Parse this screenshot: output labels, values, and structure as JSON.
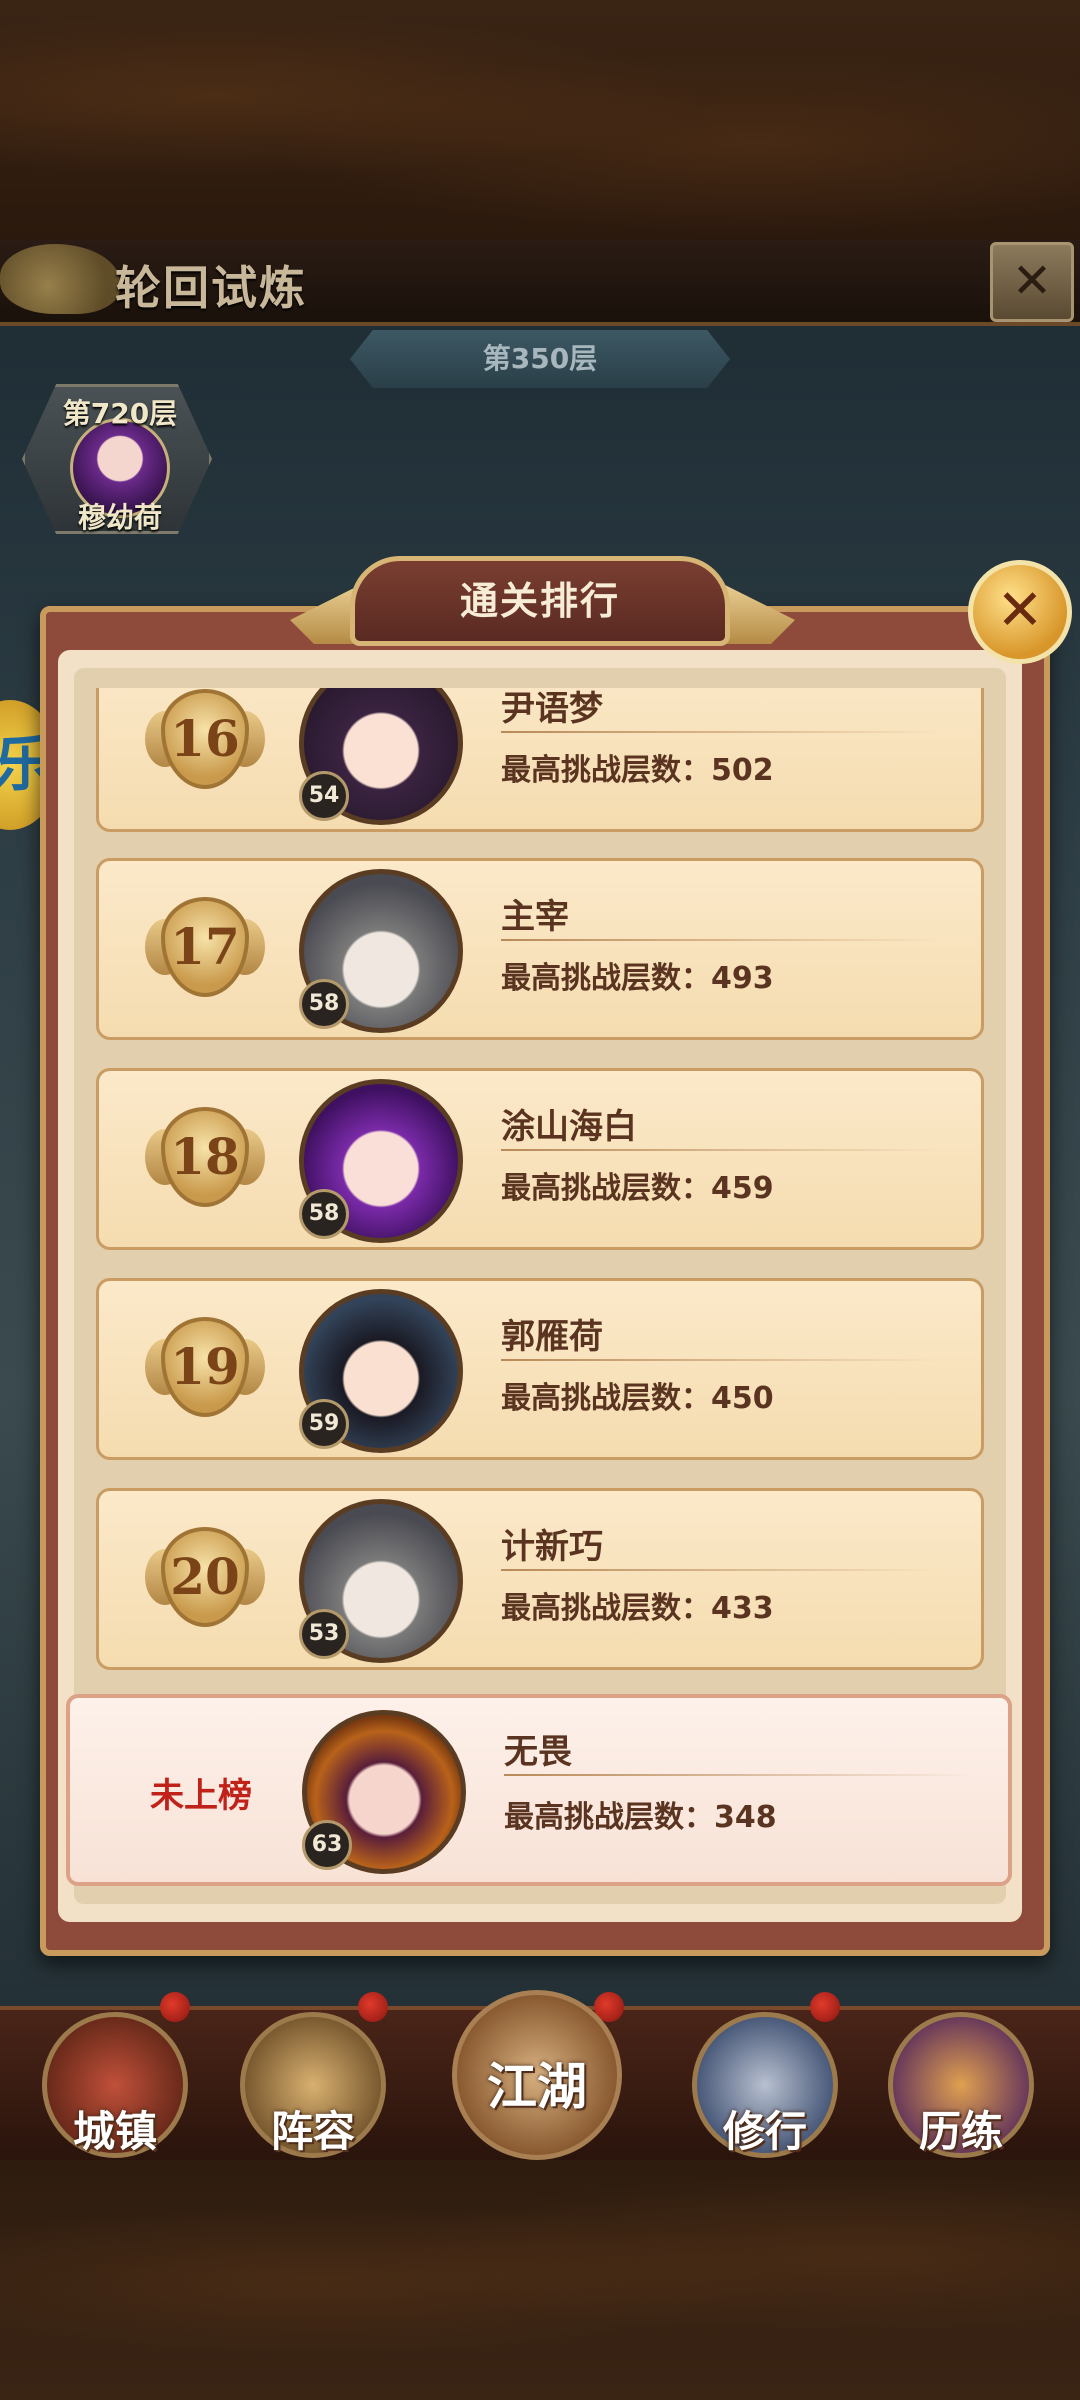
{
  "header": {
    "title": "轮回试炼",
    "close_icon": "x-icon",
    "floor_label": "第350层"
  },
  "top_badge": {
    "floor": "第720层",
    "name": "穆幼荷"
  },
  "panel": {
    "title": "通关排行",
    "close_icon": "x-icon"
  },
  "rankings": [
    {
      "rank": "16",
      "level": "54",
      "name": "尹语梦",
      "score": "最高挑战层数：502"
    },
    {
      "rank": "17",
      "level": "58",
      "name": "主宰",
      "score": "最高挑战层数：493"
    },
    {
      "rank": "18",
      "level": "58",
      "name": "涂山海白",
      "score": "最高挑战层数：459"
    },
    {
      "rank": "19",
      "level": "59",
      "name": "郭雁荷",
      "score": "最高挑战层数：450"
    },
    {
      "rank": "20",
      "level": "53",
      "name": "计新巧",
      "score": "最高挑战层数：433"
    }
  ],
  "self": {
    "rank": "未上榜",
    "level": "63",
    "name": "无畏",
    "score": "最高挑战层数：348"
  },
  "nav": {
    "items": [
      {
        "label": "城镇"
      },
      {
        "label": "阵容"
      },
      {
        "label": "江湖"
      },
      {
        "label": "修行"
      },
      {
        "label": "历练"
      }
    ]
  },
  "colors": {
    "panel_border": "#8e4a3a",
    "row_bg": "#f5dcb0",
    "self_rank": "#c0221a",
    "text_dark": "#5a3420"
  }
}
